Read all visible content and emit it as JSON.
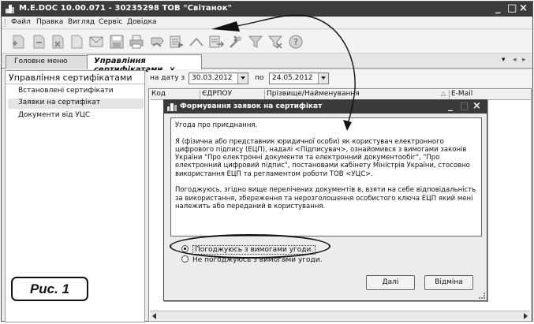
{
  "window": {
    "title": "M.E.DOC 10.00.071 - 30235298 ТОВ \"Світанок\"",
    "controls": [
      "_",
      "□",
      "×"
    ]
  },
  "menu": [
    "Файл",
    "Правка",
    "Вигляд",
    "Сервіс",
    "Довідка"
  ],
  "toolbar_icons": [
    "add-doc-icon",
    "copy-doc-icon",
    "delete-doc-icon",
    "blank-doc-icon",
    "mail-icon",
    "save-icon",
    "print-icon",
    "sign-icon",
    "send-icon",
    "receive-icon",
    "export-icon",
    "tools-icon",
    "filter-icon",
    "clear-filter-icon",
    "help-icon"
  ],
  "tabs": [
    {
      "label": "Головне меню",
      "active": false
    },
    {
      "label": "Управління сертифікатами",
      "active": true,
      "close": "×"
    }
  ],
  "tab_nav": {
    "menu_arrow": "▾",
    "left": "◂",
    "right": "▸"
  },
  "sidebar": {
    "header": "Управління сертифікатами",
    "items": [
      {
        "label": "Встановлені сертифікати",
        "selected": false
      },
      {
        "label": "Заявки на сертифікат",
        "selected": true
      },
      {
        "label": "Документи від УЦС",
        "selected": false
      }
    ]
  },
  "filter": {
    "from_label": "на дату з",
    "from_value": "30.03.2012",
    "to_label": "по",
    "to_value": "24.05.2012"
  },
  "grid": {
    "columns": [
      "Код",
      "ЄДРПОУ",
      "Прізвище/Найменування",
      "E-Mail"
    ],
    "sort_marker": "△"
  },
  "dialog": {
    "title": "Формування заявок на сертифікат",
    "controls": [
      "_",
      "□",
      "×"
    ],
    "agreement": [
      "Угода про приєднання.",
      "Я (фізична або представник юридичної особи) як користувач електронного цифрового підпису (ЕЦП), надалі <Підписувач>, ознайомився з вимогами законів України \"Про електронні документи та електронний документообіг\", \"Про електронний цифровий підпис\", постановами кабінету Міністрів України, стосовно використання ЕЦП та регламентом роботи ТОВ <УЦС>.",
      "Погоджуюсь, згідно вище перелічених документів в, взяти на себе відповідальність за використання, збереження та нерозголошення особистого ключа ЕЦП який мені належить або переданий в користування."
    ],
    "options": [
      {
        "label": "Погоджуюсь з вимогами угоди.",
        "checked": true
      },
      {
        "label": "Не погоджуюсь з вимогами угоди.",
        "checked": false
      }
    ],
    "next_button": "Далі",
    "cancel_button": "Відміна"
  },
  "figure_label": "Рис. 1"
}
